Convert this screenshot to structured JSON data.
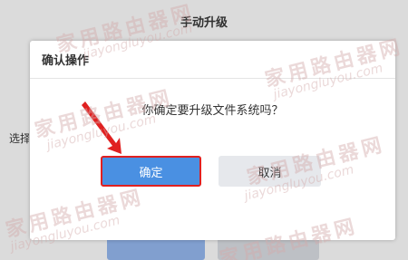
{
  "background": {
    "title": "手动升级",
    "select_label": "选择"
  },
  "dialog": {
    "title": "确认操作",
    "message": "你确定要升级文件系统吗？",
    "confirm_label": "确定",
    "cancel_label": "取消"
  },
  "watermark": {
    "text": "家用路由器网",
    "url": "jiayongluyou.com"
  },
  "colors": {
    "confirm_bg": "#4a90e2",
    "highlight": "#e02020",
    "cancel_bg": "#e6e8ec"
  }
}
